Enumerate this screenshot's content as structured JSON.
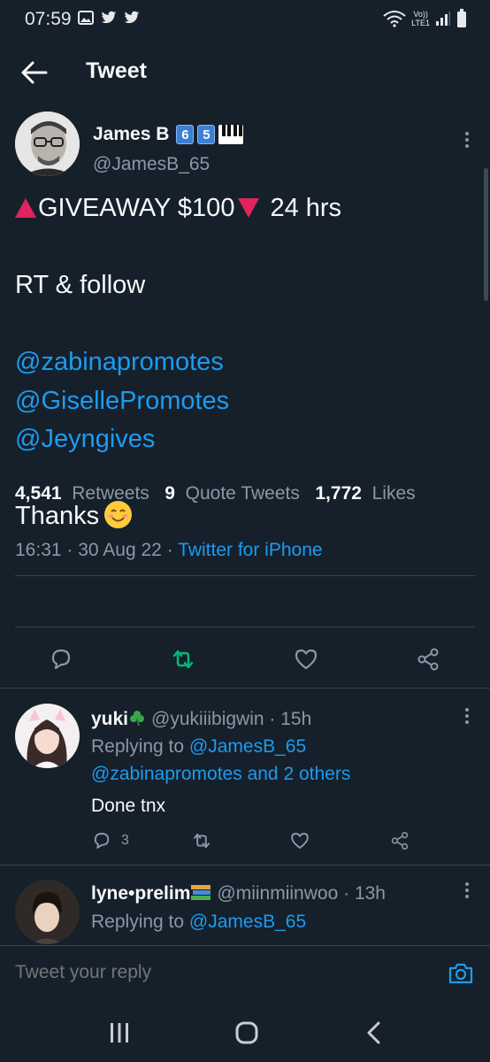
{
  "status_bar": {
    "time": "07:59",
    "left_icons": [
      "gallery-icon",
      "twitter-icon",
      "twitter-icon"
    ],
    "right_icons": [
      "wifi-icon",
      "volte-icon",
      "signal-icon",
      "battery-icon"
    ],
    "network_label_top": "Vo))",
    "network_label_bottom": "LTE1"
  },
  "header": {
    "title": "Tweet"
  },
  "main_tweet": {
    "author_name": "James B",
    "author_badges": [
      "6",
      "5"
    ],
    "author_handle": "@JamesB_65",
    "line1_text": "GIVEAWAY $100",
    "line1_suffix": "24 hrs",
    "line2": "RT & follow",
    "mentions": [
      "@zabinapromotes",
      "@GisellePromotes",
      "@Jeyngives"
    ],
    "closing": "Thanks",
    "time": "16:31",
    "date": "30 Aug 22",
    "separator": "·",
    "source": "Twitter for iPhone",
    "retweets_count": "4,541",
    "retweets_label": "Retweets",
    "quotes_count": "9",
    "quotes_label": "Quote Tweets",
    "likes_count": "1,772",
    "likes_label": "Likes"
  },
  "replies": [
    {
      "name": "yuki",
      "handle": "@yukiiibigwin",
      "time": "15h",
      "replying_prefix": "Replying to",
      "replying_to": "@JamesB_65",
      "replying_more": "@zabinapromotes and 2 others",
      "text": "Done tnx",
      "reply_count": "3"
    },
    {
      "name": "lyne•prelim",
      "handle": "@miinmiinwoo",
      "time": "13h",
      "replying_prefix": "Replying to",
      "replying_to": "@JamesB_65"
    }
  ],
  "compose": {
    "placeholder": "Tweet your reply"
  },
  "colors": {
    "background": "#15202b",
    "accent": "#1d9bf0",
    "retweet_active": "#00ba7c",
    "secondary_text": "#8b98a5",
    "divider": "#38444d"
  }
}
